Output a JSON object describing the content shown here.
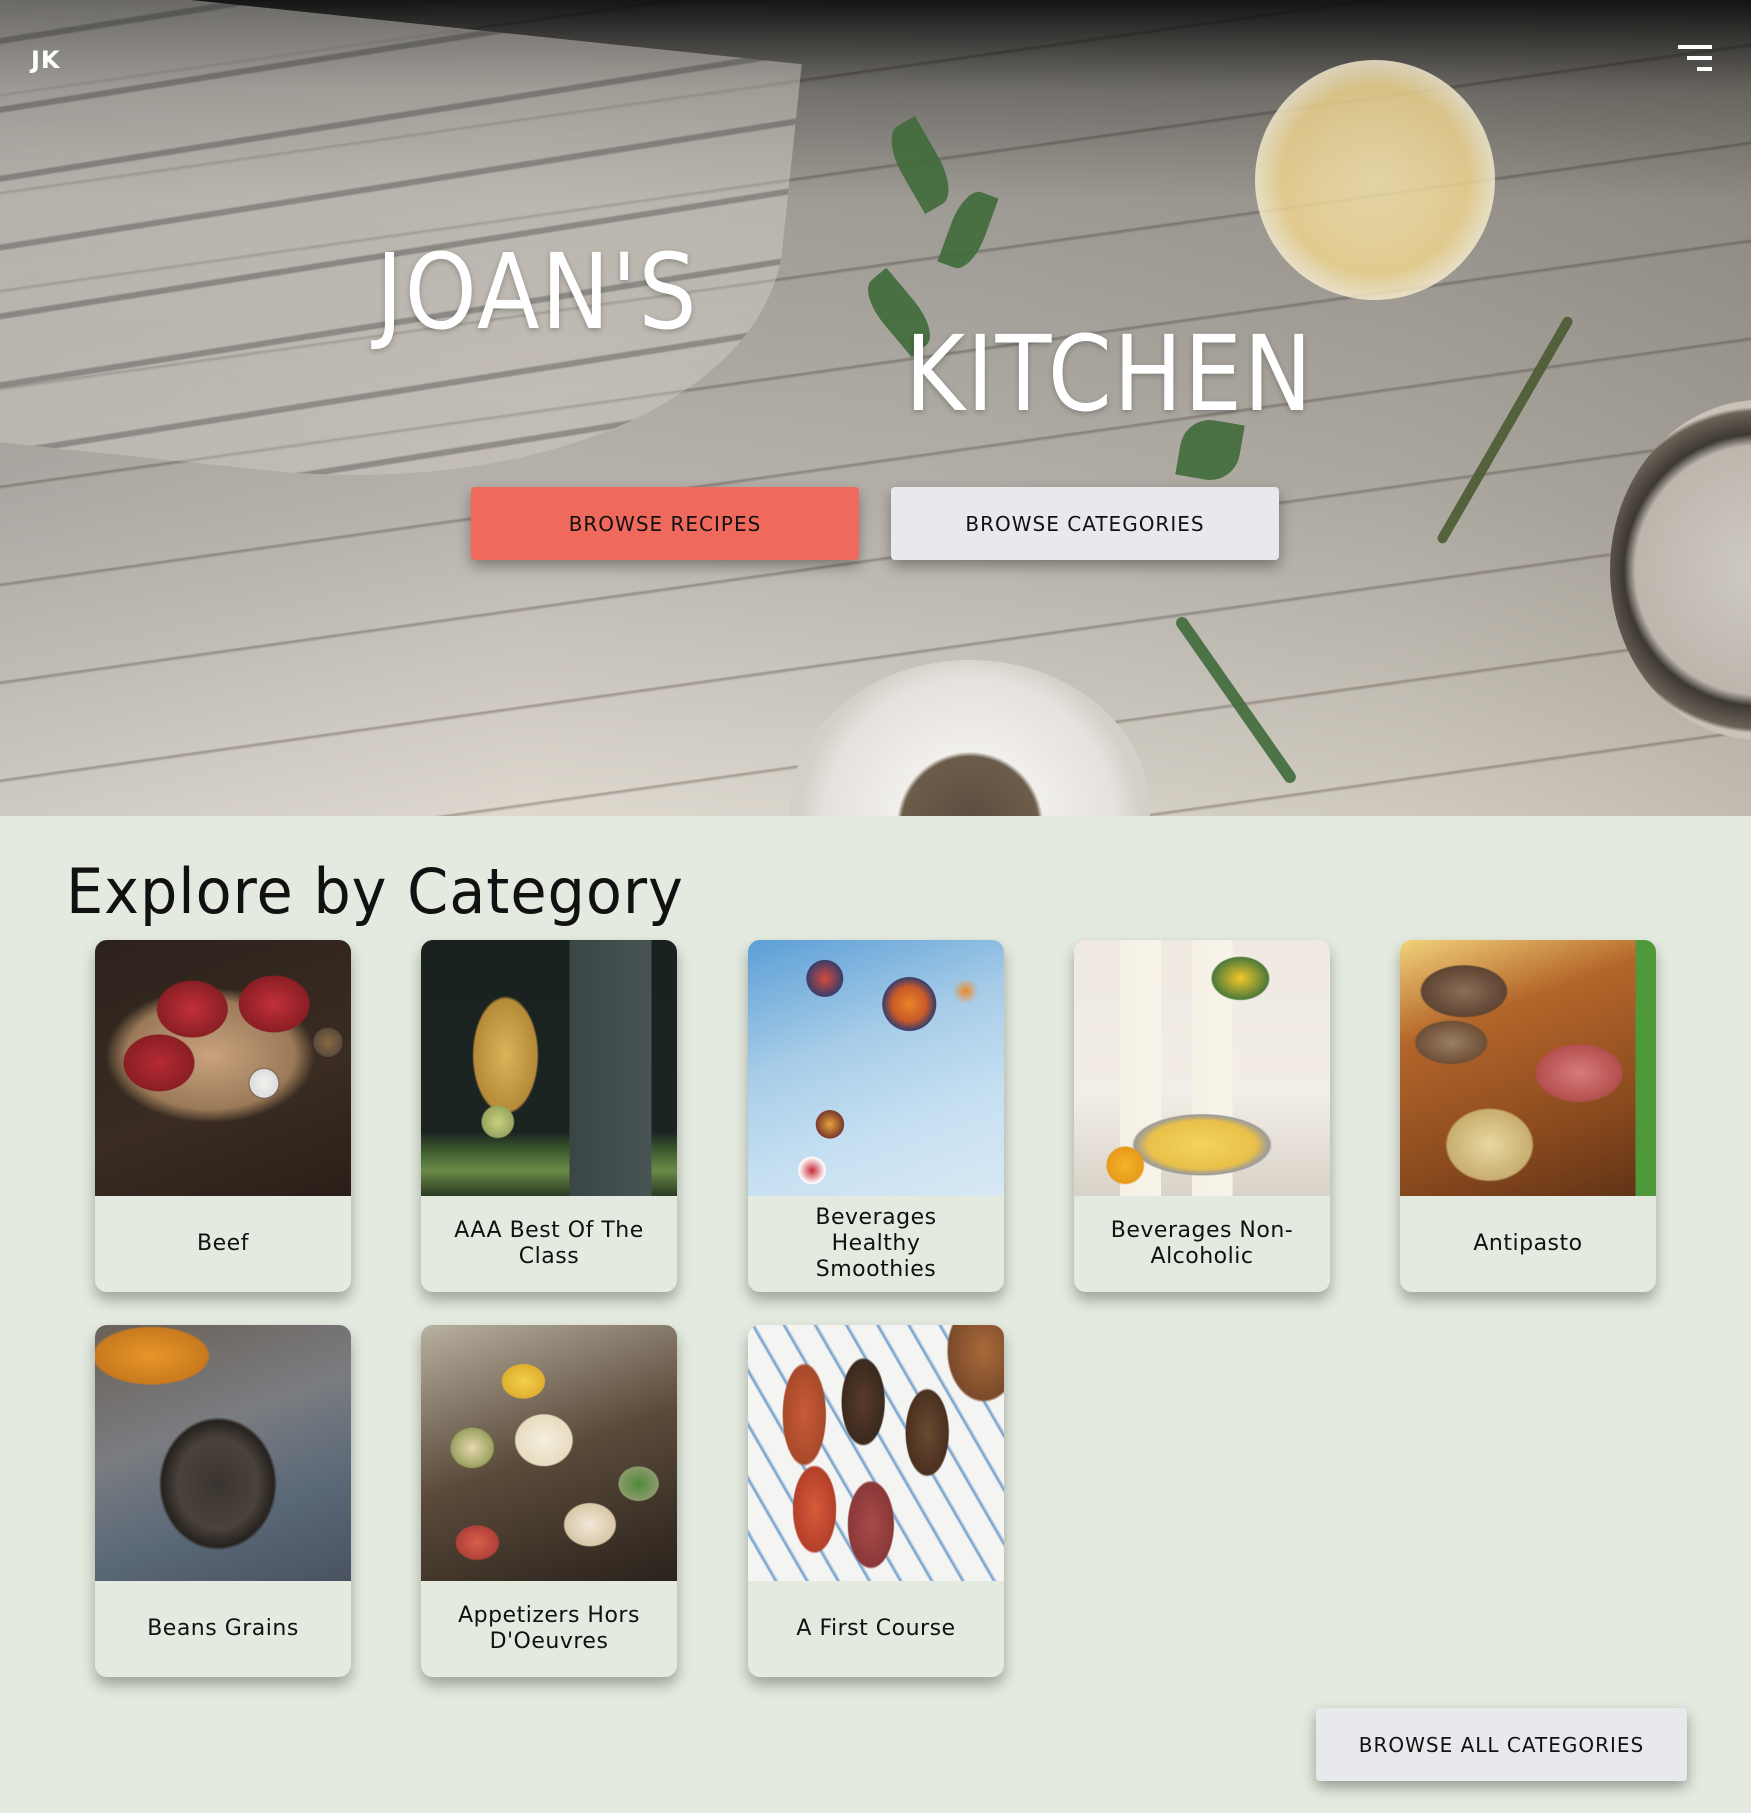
{
  "header": {
    "logo": "JK",
    "menu_icon": "hamburger-menu-icon"
  },
  "hero": {
    "title_line1": "JOAN'S",
    "title_line2": "KITCHEN",
    "primary_button": "BROWSE RECIPES",
    "secondary_button": "BROWSE CATEGORIES"
  },
  "colors": {
    "accent": "#ef6a5c",
    "button_light": "#e8e9ed",
    "page_background": "#e4eadf",
    "text": "#111111"
  },
  "categories": {
    "title": "Explore by Category",
    "items": [
      {
        "label": "Beef",
        "image": "beef-steaks"
      },
      {
        "label": "AAA Best Of The Class",
        "image": "honey-pot-and-mug"
      },
      {
        "label": "Beverages Healthy Smoothies",
        "image": "smoothie-bowls"
      },
      {
        "label": "Beverages Non-Alcoholic",
        "image": "lemonade-glasses"
      },
      {
        "label": "Antipasto",
        "image": "bread-and-prosciutto"
      },
      {
        "label": "Beans Grains",
        "image": "beans-in-burlap"
      },
      {
        "label": "Appetizers Hors D'Oeuvres",
        "image": "canapes"
      },
      {
        "label": "A First Course",
        "image": "bruschetta"
      }
    ],
    "browse_all_button": "BROWSE ALL CATEGORIES"
  }
}
